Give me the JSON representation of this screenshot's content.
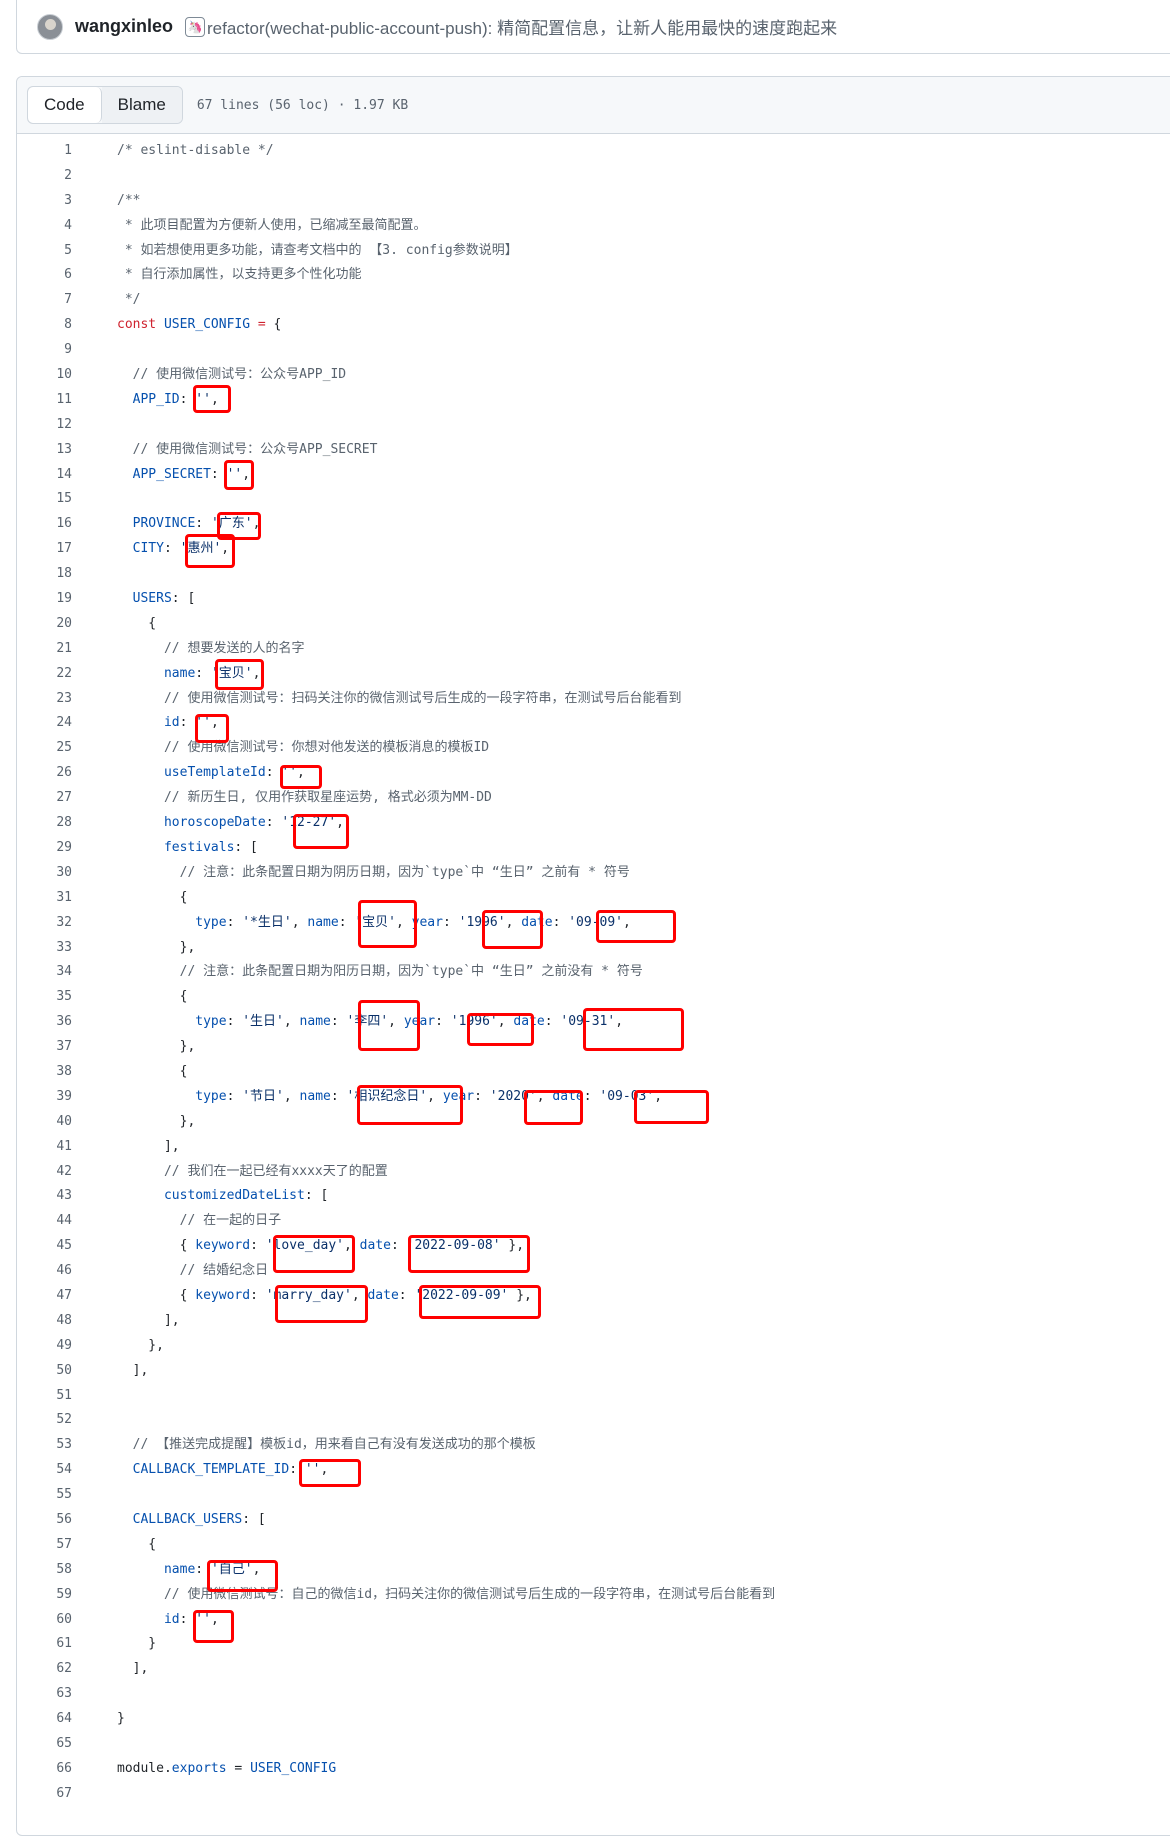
{
  "commit": {
    "author": "wangxinleo",
    "emoji_icon": "unicorn-icon",
    "message": "refactor(wechat-public-account-push): 精简配置信息，让新人能用最快的速度跑起来"
  },
  "file_header": {
    "code_tab": "Code",
    "blame_tab": "Blame",
    "file_info": "67 lines (56 loc) · 1.97 KB"
  },
  "code_lines": [
    [
      [
        "c-com",
        "/* eslint-disable */"
      ]
    ],
    [],
    [
      [
        "c-com",
        "/**"
      ]
    ],
    [
      [
        "c-com",
        " * 此项目配置为方便新人使用，已缩减至最简配置。"
      ]
    ],
    [
      [
        "c-com",
        " * 如若想使用更多功能，请查考文档中的 【3. config参数说明】"
      ]
    ],
    [
      [
        "c-com",
        " * 自行添加属性，以支持更多个性化功能"
      ]
    ],
    [
      [
        "c-com",
        " */"
      ]
    ],
    [
      [
        "c-kw",
        "const "
      ],
      [
        "c-id",
        "USER_CONFIG"
      ],
      [
        "c-kw",
        " = "
      ],
      [
        "c-pl",
        "{"
      ]
    ],
    [],
    [
      [
        "c-com",
        "  // 使用微信测试号：公众号APP_ID"
      ]
    ],
    [
      [
        "c-id",
        "  APP_ID"
      ],
      [
        "c-pl",
        ": "
      ],
      [
        "c-str",
        "''"
      ],
      [
        "c-pl",
        ","
      ]
    ],
    [],
    [
      [
        "c-com",
        "  // 使用微信测试号：公众号APP_SECRET"
      ]
    ],
    [
      [
        "c-id",
        "  APP_SECRET"
      ],
      [
        "c-pl",
        ": "
      ],
      [
        "c-str",
        "''"
      ],
      [
        "c-pl",
        ","
      ]
    ],
    [],
    [
      [
        "c-id",
        "  PROVINCE"
      ],
      [
        "c-pl",
        ": "
      ],
      [
        "c-str",
        "'广东'"
      ],
      [
        "c-pl",
        ","
      ]
    ],
    [
      [
        "c-id",
        "  CITY"
      ],
      [
        "c-pl",
        ": "
      ],
      [
        "c-str",
        "'惠州'"
      ],
      [
        "c-pl",
        ","
      ]
    ],
    [],
    [
      [
        "c-id",
        "  USERS"
      ],
      [
        "c-pl",
        ": ["
      ]
    ],
    [
      [
        "c-pl",
        "    {"
      ]
    ],
    [
      [
        "c-com",
        "      // 想要发送的人的名字"
      ]
    ],
    [
      [
        "c-id",
        "      name"
      ],
      [
        "c-pl",
        ": "
      ],
      [
        "c-str",
        "'宝贝'"
      ],
      [
        "c-pl",
        ","
      ]
    ],
    [
      [
        "c-com",
        "      // 使用微信测试号：扫码关注你的微信测试号后生成的一段字符串，在测试号后台能看到"
      ]
    ],
    [
      [
        "c-id",
        "      id"
      ],
      [
        "c-pl",
        ": "
      ],
      [
        "c-str",
        "''"
      ],
      [
        "c-pl",
        ","
      ]
    ],
    [
      [
        "c-com",
        "      // 使用微信测试号：你想对他发送的模板消息的模板ID"
      ]
    ],
    [
      [
        "c-id",
        "      useTemplateId"
      ],
      [
        "c-pl",
        ": "
      ],
      [
        "c-str",
        "''"
      ],
      [
        "c-pl",
        ","
      ]
    ],
    [
      [
        "c-com",
        "      // 新历生日, 仅用作获取星座运势, 格式必须为MM-DD"
      ]
    ],
    [
      [
        "c-id",
        "      horoscopeDate"
      ],
      [
        "c-pl",
        ": "
      ],
      [
        "c-str",
        "'12-27'"
      ],
      [
        "c-pl",
        ","
      ]
    ],
    [
      [
        "c-id",
        "      festivals"
      ],
      [
        "c-pl",
        ": ["
      ]
    ],
    [
      [
        "c-com",
        "        // 注意：此条配置日期为阴历日期，因为`type`中 “生日” 之前有 * 符号"
      ]
    ],
    [
      [
        "c-pl",
        "        {"
      ]
    ],
    [
      [
        "c-id",
        "          type"
      ],
      [
        "c-pl",
        ": "
      ],
      [
        "c-str",
        "'*生日'"
      ],
      [
        "c-pl",
        ", "
      ],
      [
        "c-id",
        "name"
      ],
      [
        "c-pl",
        ": "
      ],
      [
        "c-str",
        "'宝贝'"
      ],
      [
        "c-pl",
        ", "
      ],
      [
        "c-id",
        "year"
      ],
      [
        "c-pl",
        ": "
      ],
      [
        "c-str",
        "'1996'"
      ],
      [
        "c-pl",
        ", "
      ],
      [
        "c-id",
        "date"
      ],
      [
        "c-pl",
        ": "
      ],
      [
        "c-str",
        "'09-09'"
      ],
      [
        "c-pl",
        ","
      ]
    ],
    [
      [
        "c-pl",
        "        },"
      ]
    ],
    [
      [
        "c-com",
        "        // 注意：此条配置日期为阳历日期，因为`type`中 “生日” 之前没有 * 符号"
      ]
    ],
    [
      [
        "c-pl",
        "        {"
      ]
    ],
    [
      [
        "c-id",
        "          type"
      ],
      [
        "c-pl",
        ": "
      ],
      [
        "c-str",
        "'生日'"
      ],
      [
        "c-pl",
        ", "
      ],
      [
        "c-id",
        "name"
      ],
      [
        "c-pl",
        ": "
      ],
      [
        "c-str",
        "'李四'"
      ],
      [
        "c-pl",
        ", "
      ],
      [
        "c-id",
        "year"
      ],
      [
        "c-pl",
        ": "
      ],
      [
        "c-str",
        "'1996'"
      ],
      [
        "c-pl",
        ", "
      ],
      [
        "c-id",
        "date"
      ],
      [
        "c-pl",
        ": "
      ],
      [
        "c-str",
        "'09-31'"
      ],
      [
        "c-pl",
        ","
      ]
    ],
    [
      [
        "c-pl",
        "        },"
      ]
    ],
    [
      [
        "c-pl",
        "        {"
      ]
    ],
    [
      [
        "c-id",
        "          type"
      ],
      [
        "c-pl",
        ": "
      ],
      [
        "c-str",
        "'节日'"
      ],
      [
        "c-pl",
        ", "
      ],
      [
        "c-id",
        "name"
      ],
      [
        "c-pl",
        ": "
      ],
      [
        "c-str",
        "'相识纪念日'"
      ],
      [
        "c-pl",
        ", "
      ],
      [
        "c-id",
        "year"
      ],
      [
        "c-pl",
        ": "
      ],
      [
        "c-str",
        "'2020'"
      ],
      [
        "c-pl",
        ", "
      ],
      [
        "c-id",
        "date"
      ],
      [
        "c-pl",
        ": "
      ],
      [
        "c-str",
        "'09-03'"
      ],
      [
        "c-pl",
        ","
      ]
    ],
    [
      [
        "c-pl",
        "        },"
      ]
    ],
    [
      [
        "c-pl",
        "      ],"
      ]
    ],
    [
      [
        "c-com",
        "      // 我们在一起已经有xxxx天了的配置"
      ]
    ],
    [
      [
        "c-id",
        "      customizedDateList"
      ],
      [
        "c-pl",
        ": ["
      ]
    ],
    [
      [
        "c-com",
        "        // 在一起的日子"
      ]
    ],
    [
      [
        "c-pl",
        "        { "
      ],
      [
        "c-id",
        "keyword"
      ],
      [
        "c-pl",
        ": "
      ],
      [
        "c-str",
        "'love_day'"
      ],
      [
        "c-pl",
        ", "
      ],
      [
        "c-id",
        "date"
      ],
      [
        "c-pl",
        ": "
      ],
      [
        "c-str",
        "'2022-09-08'"
      ],
      [
        "c-pl",
        " },"
      ]
    ],
    [
      [
        "c-com",
        "        // 结婚纪念日"
      ]
    ],
    [
      [
        "c-pl",
        "        { "
      ],
      [
        "c-id",
        "keyword"
      ],
      [
        "c-pl",
        ": "
      ],
      [
        "c-str",
        "'marry_day'"
      ],
      [
        "c-pl",
        ", "
      ],
      [
        "c-id",
        "date"
      ],
      [
        "c-pl",
        ": "
      ],
      [
        "c-str",
        "'2022-09-09'"
      ],
      [
        "c-pl",
        " },"
      ]
    ],
    [
      [
        "c-pl",
        "      ],"
      ]
    ],
    [
      [
        "c-pl",
        "    },"
      ]
    ],
    [
      [
        "c-pl",
        "  ],"
      ]
    ],
    [],
    [],
    [
      [
        "c-com",
        "  // 【推送完成提醒】模板id，用来看自己有没有发送成功的那个模板"
      ]
    ],
    [
      [
        "c-id",
        "  CALLBACK_TEMPLATE_ID"
      ],
      [
        "c-pl",
        ": "
      ],
      [
        "c-str",
        "''"
      ],
      [
        "c-pl",
        ","
      ]
    ],
    [],
    [
      [
        "c-id",
        "  CALLBACK_USERS"
      ],
      [
        "c-pl",
        ": ["
      ]
    ],
    [
      [
        "c-pl",
        "    {"
      ]
    ],
    [
      [
        "c-id",
        "      name"
      ],
      [
        "c-pl",
        ": "
      ],
      [
        "c-str",
        "'自己'"
      ],
      [
        "c-pl",
        ","
      ]
    ],
    [
      [
        "c-com",
        "      // 使用微信测试号：自己的微信id，扫码关注你的微信测试号后生成的一段字符串，在测试号后台能看到"
      ]
    ],
    [
      [
        "c-id",
        "      id"
      ],
      [
        "c-pl",
        ": "
      ],
      [
        "c-str",
        "''"
      ],
      [
        "c-pl",
        ","
      ]
    ],
    [
      [
        "c-pl",
        "    }"
      ]
    ],
    [
      [
        "c-pl",
        "  ],"
      ]
    ],
    [],
    [
      [
        "c-pl",
        "}"
      ]
    ],
    [],
    [
      [
        "c-pl",
        "module"
      ],
      [
        "c-pl",
        "."
      ],
      [
        "c-id",
        "exports"
      ],
      [
        "c-pl",
        " = "
      ],
      [
        "c-id",
        "USER_CONFIG"
      ]
    ],
    []
  ]
}
